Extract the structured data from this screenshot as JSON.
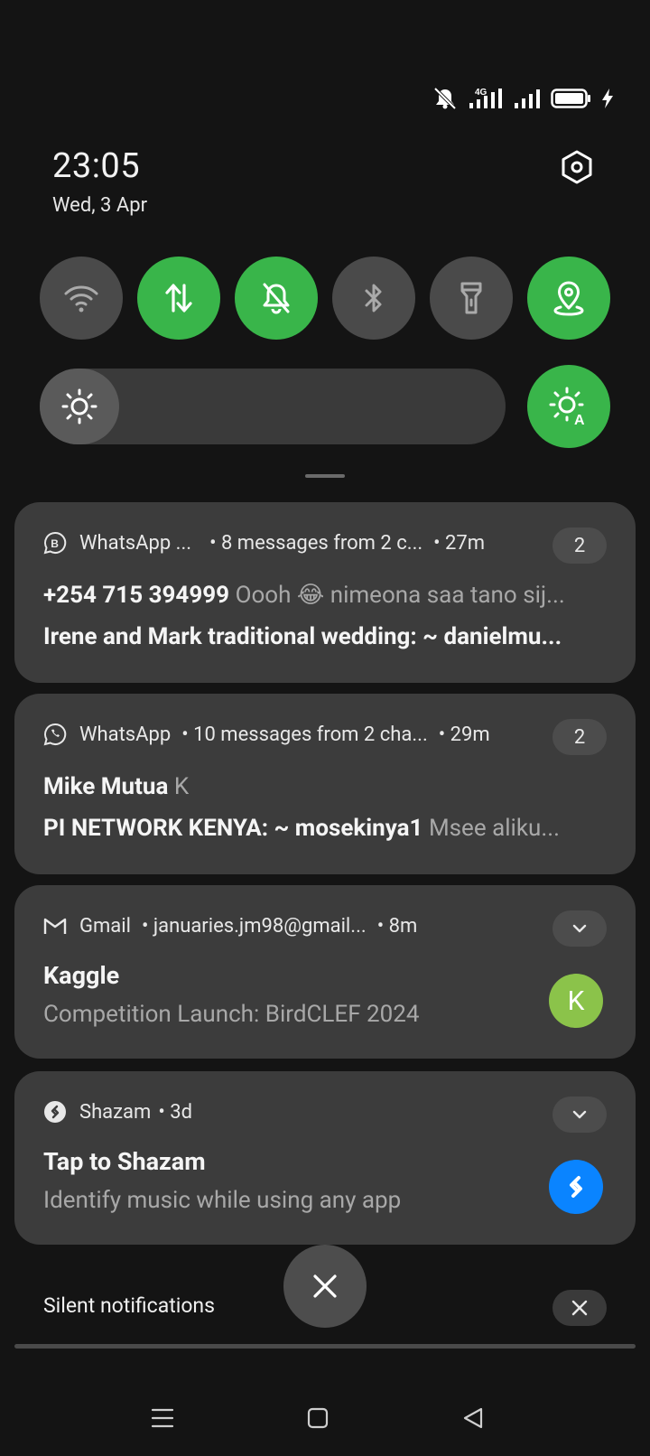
{
  "status_bar": {
    "network_label": "4G",
    "icons": [
      "mute-icon",
      "signal-4g-icon",
      "signal-icon",
      "battery-icon",
      "charging-icon"
    ]
  },
  "header": {
    "time": "23:05",
    "date": "Wed, 3 Apr"
  },
  "quick_settings": {
    "tiles": [
      {
        "icon": "wifi-icon",
        "state": "off"
      },
      {
        "icon": "mobile-data-icon",
        "state": "on"
      },
      {
        "icon": "bell-off-icon",
        "state": "on"
      },
      {
        "icon": "bluetooth-icon",
        "state": "off"
      },
      {
        "icon": "flashlight-icon",
        "state": "off"
      },
      {
        "icon": "location-icon",
        "state": "on"
      }
    ],
    "brightness_level": 0.17,
    "auto_brightness": "on"
  },
  "notifications": [
    {
      "app": "WhatsApp ...",
      "summary": "• 8 messages from 2 c...",
      "time": "• 27m",
      "count": "2",
      "line1_bold": "+254 715 394999",
      "line1_text": "Oooh 😂 nimeona saa tano sij...",
      "line2_bold": "Irene and Mark traditional wedding: ~ danielmu...",
      "line2_text": ""
    },
    {
      "app": "WhatsApp",
      "summary": "• 10 messages from 2 cha...",
      "time": "• 29m",
      "count": "2",
      "line1_bold": "Mike Mutua",
      "line1_text": "K",
      "line2_bold": "PI NETWORK KENYA: ~ mosekinya1",
      "line2_text": "Msee aliku..."
    },
    {
      "app": "Gmail",
      "summary": "• januaries.jm98@gmail...",
      "time": "• 8m",
      "title": "Kaggle",
      "subtitle": "Competition Launch: BirdCLEF 2024",
      "avatar_letter": "K",
      "avatar_color": "#8bc34a"
    },
    {
      "app": "Shazam",
      "summary": "",
      "time": "• 3d",
      "title": "Tap to Shazam",
      "subtitle": "Identify music while using any app",
      "avatar_color": "#0a84ff"
    }
  ],
  "silent": {
    "label": "Silent notifications"
  },
  "colors": {
    "accent_green": "#39b54a",
    "tile_off": "#4a4a4a",
    "card_bg": "#3c3c3c"
  }
}
